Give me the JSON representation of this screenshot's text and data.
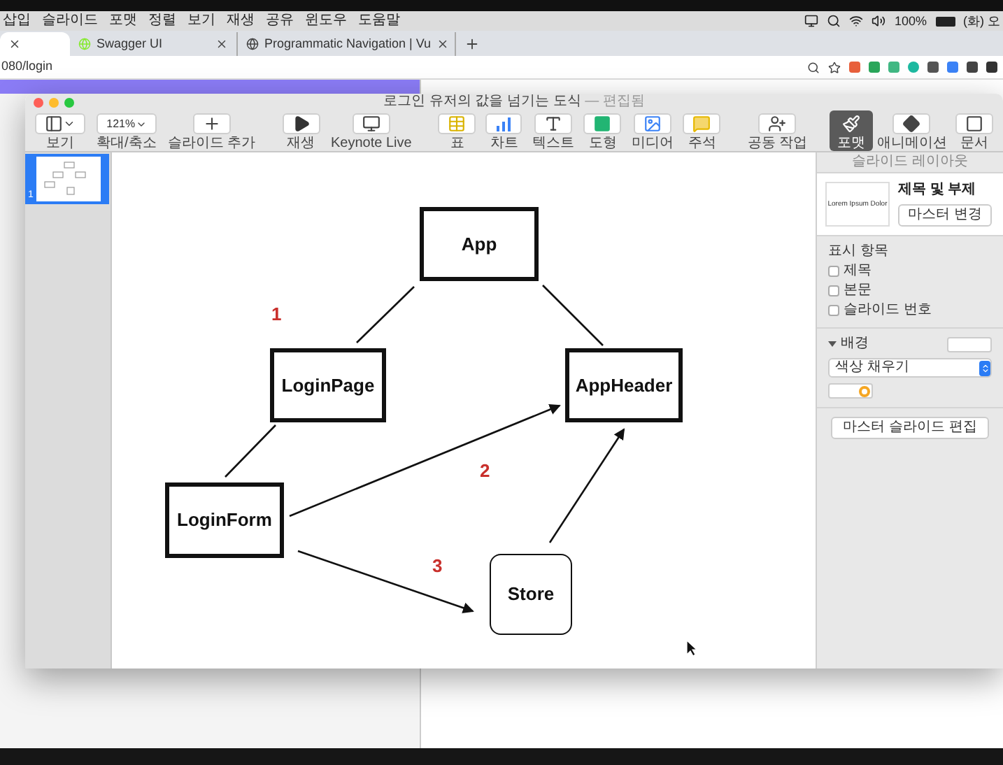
{
  "menu_bar": {
    "items": [
      "삽입",
      "슬라이드",
      "포맷",
      "정렬",
      "보기",
      "재생",
      "공유",
      "윈도우",
      "도움말"
    ],
    "battery": "100%",
    "clock": "(화) 오"
  },
  "browser": {
    "tabs": [
      {
        "selected": true
      },
      {
        "title": "Swagger UI",
        "selected": false
      },
      {
        "title": "Programmatic Navigation | Vu",
        "selected": false
      }
    ],
    "address": "080/login"
  },
  "keynote": {
    "title": "로그인 유저의 값을 넘기는 도식",
    "status": "— 편집됨",
    "toolbar": [
      {
        "label": "보기",
        "kind": "view"
      },
      {
        "label": "확대/축소",
        "kind": "zoom",
        "value": "121%"
      },
      {
        "label": "슬라이드 추가",
        "kind": "add"
      },
      {
        "label": "재생",
        "kind": "play"
      },
      {
        "label": "Keynote Live",
        "kind": "live"
      },
      {
        "label": "표",
        "kind": "table"
      },
      {
        "label": "차트",
        "kind": "chart"
      },
      {
        "label": "텍스트",
        "kind": "text"
      },
      {
        "label": "도형",
        "kind": "shape"
      },
      {
        "label": "미디어",
        "kind": "media"
      },
      {
        "label": "주석",
        "kind": "comment"
      },
      {
        "label": "공동 작업",
        "kind": "collaborate"
      },
      {
        "label": "포맷",
        "kind": "format",
        "selected": true
      },
      {
        "label": "애니메이션",
        "kind": "animate",
        "selected": false
      },
      {
        "label": "문서",
        "kind": "document",
        "selected": false
      }
    ],
    "slides": [
      {
        "number": "1",
        "selected": true
      }
    ],
    "nodes": [
      {
        "label": "App",
        "kind": "box"
      },
      {
        "label": "LoginPage",
        "kind": "box"
      },
      {
        "label": "AppHeader",
        "kind": "box"
      },
      {
        "label": "LoginForm",
        "kind": "box"
      },
      {
        "label": "Store",
        "kind": "rounded"
      }
    ],
    "step_labels": [
      "1",
      "2",
      "3"
    ],
    "inspector": {
      "header": "슬라이드 레이아웃",
      "layout_preview": "Lorem Ipsum Dolor",
      "layout_name": "제목 및 부제",
      "change_master": "마스터 변경",
      "show_heading": "표시 항목",
      "options": [
        {
          "label": "제목",
          "checked": false
        },
        {
          "label": "본문",
          "checked": false
        },
        {
          "label": "슬라이드 번호",
          "checked": false
        }
      ],
      "background": {
        "label": "배경",
        "expanded": true,
        "fill": "색상 채우기"
      },
      "edit_master": "마스터 슬라이드 편집"
    }
  }
}
